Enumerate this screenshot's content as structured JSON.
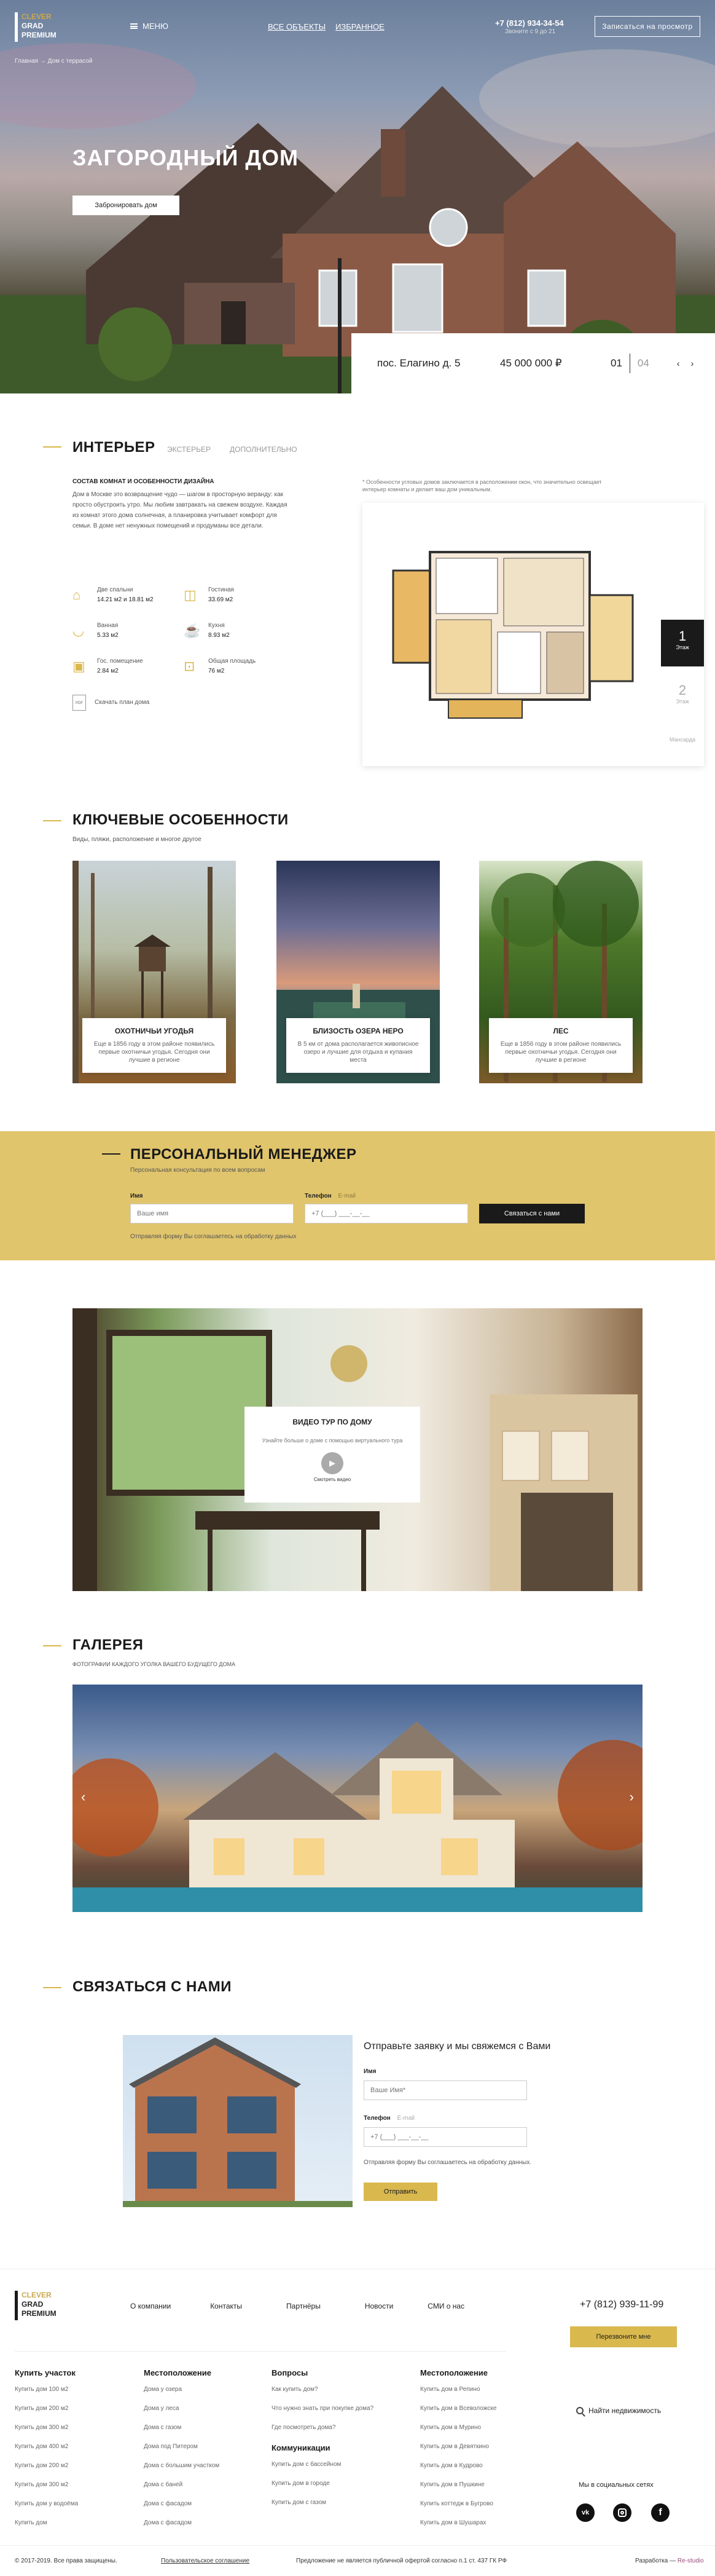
{
  "header": {
    "logo": [
      "CLEVER",
      "GRAD",
      "PREMIUM"
    ],
    "menu": "МЕНЮ",
    "nav": [
      "ВСЕ ОБЪЕКТЫ",
      "ИЗБРАННОЕ"
    ],
    "phone": "+7 (812) 934-34-54",
    "hours": "Звоните с 9 до 21",
    "cta": "Записаться на просмотр"
  },
  "breadcrumb": [
    "Главная",
    "Дом с террасой"
  ],
  "hero": {
    "title": "ЗАГОРОДНЫЙ ДОМ",
    "button": "Забронировать дом",
    "address": "пос. Елагино д. 5",
    "price": "45 000 000 ₽",
    "slide": "01",
    "total": "04"
  },
  "interior": {
    "title": "ИНТЕРЬЕР",
    "tabs": [
      "ИНТЕРЬЕР",
      "ЭКСТЕРЬЕР",
      "ДОПОЛНИТЕЛЬНО"
    ],
    "subhead": "СОСТАВ КОМНАТ И ОСОБЕННОСТИ ДИЗАЙНА",
    "text": "Дом в Москве это возвращение чудо — шагом в просторную веранду: как просто обустроить утро. Мы любим завтракать на свежем воздухе. Каждая из комнат этого дома солнечная, а планировка учитывает комфорт для семьи. В доме нет ненужных помещений и продуманы все детали.",
    "rooms": [
      {
        "name": "Две спальни",
        "val": "14.21 м2 и 18.81 м2"
      },
      {
        "name": "Гостиная",
        "val": "33.69 м2"
      },
      {
        "name": "Ванная",
        "val": "5.33 м2"
      },
      {
        "name": "Кухня",
        "val": "8.93 м2"
      },
      {
        "name": "Гос. помещение",
        "val": "2.84 м2"
      },
      {
        "name": "Общая площадь",
        "val": "76 м2"
      }
    ],
    "download": "Скачать план дома",
    "plan_note": "* Особенности угловых домов заключается в расположении окон, что значительно освещает интерьер комнаты и делает ваш дом уникальным.",
    "floors": [
      {
        "num": "1",
        "label": "Этаж"
      },
      {
        "num": "2",
        "label": "Этаж"
      }
    ],
    "mansard": "Мансарда"
  },
  "features": {
    "title": "КЛЮЧЕВЫЕ ОСОБЕННОСТИ",
    "subtitle": "Виды, пляжи, расположение и многое другое",
    "cards": [
      {
        "title": "ОХОТНИЧЬИ УГОДЬЯ",
        "text": "Еще в 1856 году в этом районе появились первые охотничьи угодья. Сегодня они лучшие в регионе"
      },
      {
        "title": "БЛИЗОСТЬ ОЗЕРА НЕРО",
        "text": "В 5 км от дома располагается живописное озеро и лучшие для отдыха и купания места"
      },
      {
        "title": "ЛЕС",
        "text": "Еще в 1856 году в этом районе появились первые охотничьи угодья. Сегодня они лучшие в регионе"
      }
    ]
  },
  "manager": {
    "title": "ПЕРСОНАЛЬНЫЙ МЕНЕДЖЕР",
    "subtitle": "Персональная консультация по всем вопросам",
    "name_label": "Имя",
    "name_ph": "Ваше имя",
    "phone_label": "Телефон",
    "email_label": "E-mail",
    "phone_ph": "+7 (___) ___-__-__",
    "button": "Связаться с нами",
    "consent": "Отправляя форму Вы соглашаетесь на обработку данных"
  },
  "tour": {
    "title": "ВИДЕО ТУР ПО ДОМУ",
    "text": "Узнайте больше о доме с помощью виртуального тура",
    "play": "Смотреть видео"
  },
  "gallery": {
    "title": "ГАЛЕРЕЯ",
    "subtitle": "ФОТОГРАФИИ КАЖДОГО УГОЛКА ВАШЕГО БУДУЩЕГО ДОМА"
  },
  "contact": {
    "title": "СВЯЗАТЬСЯ С НАМИ",
    "form_title": "Отправьте заявку и мы свяжемся с Вами",
    "name_label": "Имя",
    "name_ph": "Ваше Имя*",
    "phone_label": "Телефон",
    "email_label": "E-mail",
    "phone_ph": "+7 (___) ___-__-__",
    "consent": "Отправляя форму Вы соглашаетесь на обработку данных.",
    "button": "Отправить"
  },
  "footer": {
    "nav": [
      "О компании",
      "Контакты",
      "Партнёры",
      "Новости",
      "СМИ о нас"
    ],
    "phone": "+7 (812) 939-11-99",
    "callback": "Перезвоните мне",
    "search": "Найти недвижимость",
    "social_title": "Мы в социальных сетях",
    "cols": [
      {
        "title": "Купить участок",
        "items": [
          "Купить дом 100 м2",
          "Купить дом 200 м2",
          "Купить дом 300 м2",
          "Купить дом 400 м2",
          "Купить дом 200 м2",
          "Купить дом 300 м2",
          "Купить дом у водоёма",
          "Купить дом"
        ]
      },
      {
        "title": "Местоположение",
        "items": [
          "Дома у озера",
          "Дома у леса",
          "Дома с газом",
          "Дома под Питером",
          "Дома с большим участком",
          "Дома с баней",
          "Дома с фасадом",
          "Дома с фасадом"
        ]
      },
      {
        "title": "Вопросы",
        "items": [
          "Как купить дом?",
          "Что нужно знать при покупке дома?",
          "Где посмотреть дома?"
        ],
        "title2": "Коммуникации",
        "items2": [
          "Купить дом с бассейном",
          "Купить дом в городе",
          "Купить дом с газом"
        ]
      },
      {
        "title": "Местоположение",
        "items": [
          "Купить дом в Репино",
          "Купить дом в Всеволожске",
          "Купить дом в Мурино",
          "Купить дом в Девяткино",
          "Купить дом в Кудрово",
          "Купить дом в Пушкине",
          "Купить коттедж в Бугрово",
          "Купить дом в Шушарах"
        ]
      }
    ],
    "copyright": "© 2017-2019. Все права защищены.",
    "policy": "Пользовательское соглашение",
    "offer": "Предложение не является публичной офертой согласно п.1 ст. 437 ГК РФ",
    "dev": "Разработка —",
    "dev_name": "Re-studio"
  },
  "colors": {
    "accent": "#d9b84e",
    "manager_bg": "#e1c56c",
    "dark": "#1a1a1a"
  }
}
